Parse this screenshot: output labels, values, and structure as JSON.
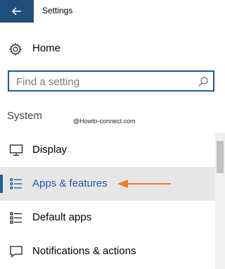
{
  "window": {
    "title": "Settings"
  },
  "home": {
    "label": "Home"
  },
  "search": {
    "placeholder": "Find a setting"
  },
  "section": {
    "label": "System"
  },
  "watermark": "@Howto-connect.com",
  "nav": {
    "items": [
      {
        "label": "Display",
        "icon": "monitor-icon",
        "selected": false
      },
      {
        "label": "Apps & features",
        "icon": "list-icon",
        "selected": true
      },
      {
        "label": "Default apps",
        "icon": "default-apps-icon",
        "selected": false
      },
      {
        "label": "Notifications & actions",
        "icon": "notification-icon",
        "selected": false
      }
    ]
  },
  "colors": {
    "accent": "#1f4e7d",
    "selected_text": "#1f5aa0",
    "selected_bg": "#e6e6e6",
    "arrow": "#f07a2a"
  }
}
